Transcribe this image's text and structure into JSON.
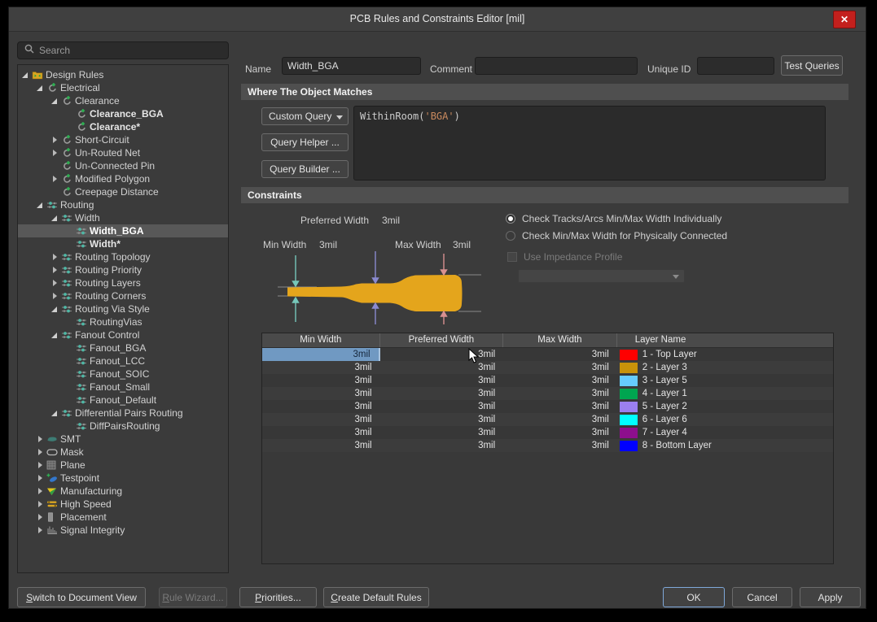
{
  "window": {
    "title": "PCB Rules and Constraints Editor [mil]",
    "close_label": "✕"
  },
  "sidebar": {
    "search_placeholder": "Search",
    "tree": [
      {
        "label": "Design Rules",
        "level": 0,
        "exp": "open",
        "icon": "folder-icon",
        "bold": false,
        "selected": false
      },
      {
        "label": "Electrical",
        "level": 1,
        "exp": "open",
        "icon": "rule-icon",
        "bold": false,
        "selected": false
      },
      {
        "label": "Clearance",
        "level": 2,
        "exp": "open",
        "icon": "rule-icon",
        "bold": false,
        "selected": false
      },
      {
        "label": "Clearance_BGA",
        "level": 3,
        "exp": "none",
        "icon": "rule-icon",
        "bold": true,
        "selected": false
      },
      {
        "label": "Clearance*",
        "level": 3,
        "exp": "none",
        "icon": "rule-icon",
        "bold": true,
        "selected": false
      },
      {
        "label": "Short-Circuit",
        "level": 2,
        "exp": "closed",
        "icon": "rule-icon",
        "bold": false,
        "selected": false
      },
      {
        "label": "Un-Routed Net",
        "level": 2,
        "exp": "closed",
        "icon": "rule-icon",
        "bold": false,
        "selected": false
      },
      {
        "label": "Un-Connected Pin",
        "level": 2,
        "exp": "none",
        "icon": "rule-icon",
        "bold": false,
        "selected": false
      },
      {
        "label": "Modified Polygon",
        "level": 2,
        "exp": "closed",
        "icon": "rule-icon",
        "bold": false,
        "selected": false
      },
      {
        "label": "Creepage Distance",
        "level": 2,
        "exp": "none",
        "icon": "rule-icon",
        "bold": false,
        "selected": false
      },
      {
        "label": "Routing",
        "level": 1,
        "exp": "open",
        "icon": "routing-icon",
        "bold": false,
        "selected": false
      },
      {
        "label": "Width",
        "level": 2,
        "exp": "open",
        "icon": "routing-icon",
        "bold": false,
        "selected": false
      },
      {
        "label": "Width_BGA",
        "level": 3,
        "exp": "none",
        "icon": "routing-icon",
        "bold": true,
        "selected": true
      },
      {
        "label": "Width*",
        "level": 3,
        "exp": "none",
        "icon": "routing-icon",
        "bold": true,
        "selected": false
      },
      {
        "label": "Routing Topology",
        "level": 2,
        "exp": "closed",
        "icon": "routing-icon",
        "bold": false,
        "selected": false
      },
      {
        "label": "Routing Priority",
        "level": 2,
        "exp": "closed",
        "icon": "routing-icon",
        "bold": false,
        "selected": false
      },
      {
        "label": "Routing Layers",
        "level": 2,
        "exp": "closed",
        "icon": "routing-icon",
        "bold": false,
        "selected": false
      },
      {
        "label": "Routing Corners",
        "level": 2,
        "exp": "closed",
        "icon": "routing-icon",
        "bold": false,
        "selected": false
      },
      {
        "label": "Routing Via Style",
        "level": 2,
        "exp": "open",
        "icon": "routing-icon",
        "bold": false,
        "selected": false
      },
      {
        "label": "RoutingVias",
        "level": 3,
        "exp": "none",
        "icon": "routing-icon",
        "bold": false,
        "selected": false
      },
      {
        "label": "Fanout Control",
        "level": 2,
        "exp": "open",
        "icon": "routing-icon",
        "bold": false,
        "selected": false
      },
      {
        "label": "Fanout_BGA",
        "level": 3,
        "exp": "none",
        "icon": "routing-icon",
        "bold": false,
        "selected": false
      },
      {
        "label": "Fanout_LCC",
        "level": 3,
        "exp": "none",
        "icon": "routing-icon",
        "bold": false,
        "selected": false
      },
      {
        "label": "Fanout_SOIC",
        "level": 3,
        "exp": "none",
        "icon": "routing-icon",
        "bold": false,
        "selected": false
      },
      {
        "label": "Fanout_Small",
        "level": 3,
        "exp": "none",
        "icon": "routing-icon",
        "bold": false,
        "selected": false
      },
      {
        "label": "Fanout_Default",
        "level": 3,
        "exp": "none",
        "icon": "routing-icon",
        "bold": false,
        "selected": false
      },
      {
        "label": "Differential Pairs Routing",
        "level": 2,
        "exp": "open",
        "icon": "routing-icon",
        "bold": false,
        "selected": false
      },
      {
        "label": "DiffPairsRouting",
        "level": 3,
        "exp": "none",
        "icon": "routing-icon",
        "bold": false,
        "selected": false
      },
      {
        "label": "SMT",
        "level": 1,
        "exp": "closed",
        "icon": "smt-icon",
        "bold": false,
        "selected": false
      },
      {
        "label": "Mask",
        "level": 1,
        "exp": "closed",
        "icon": "mask-icon",
        "bold": false,
        "selected": false
      },
      {
        "label": "Plane",
        "level": 1,
        "exp": "closed",
        "icon": "plane-icon",
        "bold": false,
        "selected": false
      },
      {
        "label": "Testpoint",
        "level": 1,
        "exp": "closed",
        "icon": "testpoint-icon",
        "bold": false,
        "selected": false
      },
      {
        "label": "Manufacturing",
        "level": 1,
        "exp": "closed",
        "icon": "manufacturing-icon",
        "bold": false,
        "selected": false
      },
      {
        "label": "High Speed",
        "level": 1,
        "exp": "closed",
        "icon": "highspeed-icon",
        "bold": false,
        "selected": false
      },
      {
        "label": "Placement",
        "level": 1,
        "exp": "closed",
        "icon": "placement-icon",
        "bold": false,
        "selected": false
      },
      {
        "label": "Signal Integrity",
        "level": 1,
        "exp": "closed",
        "icon": "signal-icon",
        "bold": false,
        "selected": false
      }
    ]
  },
  "form": {
    "name_label": "Name",
    "name_value": "Width_BGA",
    "comment_label": "Comment",
    "comment_value": "",
    "unique_id_label": "Unique ID",
    "unique_id_value": "",
    "test_queries_label": "Test Queries"
  },
  "where": {
    "header": "Where The Object Matches",
    "custom_query_label": "Custom Query",
    "query_helper_label": "Query Helper ...",
    "query_builder_label": "Query Builder ...",
    "query_prefix": "WithinRoom(",
    "query_string": "'BGA'",
    "query_suffix": ")"
  },
  "constraints": {
    "header": "Constraints",
    "preferred_width_label": "Preferred Width",
    "preferred_width_value": "3mil",
    "min_width_label": "Min Width",
    "min_width_value": "3mil",
    "max_width_label": "Max Width",
    "max_width_value": "3mil",
    "radio1_label": "Check Tracks/Arcs Min/Max Width Individually",
    "radio1_selected": true,
    "radio2_label": "Check Min/Max Width for Physically Connected",
    "radio2_selected": false,
    "impedance_label": "Use Impedance Profile",
    "impedance_enabled": false,
    "impedance_value": ""
  },
  "table": {
    "headers": [
      "Min Width",
      "Preferred Width",
      "Max Width",
      "Layer Name"
    ],
    "selected_cell": {
      "row": 0,
      "col": 0
    },
    "rows": [
      {
        "min": "3mil",
        "preferred": "3mil",
        "max": "3mil",
        "layer": "1 - Top Layer",
        "color": "#ff0000"
      },
      {
        "min": "3mil",
        "preferred": "3mil",
        "max": "3mil",
        "layer": "2 - Layer 3",
        "color": "#c9920a"
      },
      {
        "min": "3mil",
        "preferred": "3mil",
        "max": "3mil",
        "layer": "3 - Layer 5",
        "color": "#66ccff"
      },
      {
        "min": "3mil",
        "preferred": "3mil",
        "max": "3mil",
        "layer": "4 - Layer 1",
        "color": "#00a550"
      },
      {
        "min": "3mil",
        "preferred": "3mil",
        "max": "3mil",
        "layer": "5 - Layer 2",
        "color": "#9b7ff0"
      },
      {
        "min": "3mil",
        "preferred": "3mil",
        "max": "3mil",
        "layer": "6 - Layer 6",
        "color": "#00ffff"
      },
      {
        "min": "3mil",
        "preferred": "3mil",
        "max": "3mil",
        "layer": "7 - Layer 4",
        "color": "#8d0f8d"
      },
      {
        "min": "3mil",
        "preferred": "3mil",
        "max": "3mil",
        "layer": "8 - Bottom Layer",
        "color": "#0000ff"
      }
    ]
  },
  "footer": {
    "left_buttons": [
      {
        "label": "Switch to Document View",
        "underline": "S",
        "enabled": true
      },
      {
        "label": "Rule Wizard...",
        "underline": "R",
        "enabled": false
      },
      {
        "label": "Priorities...",
        "underline": "P",
        "enabled": true
      },
      {
        "label": "Create Default Rules",
        "underline": "C",
        "enabled": true
      }
    ],
    "right_buttons": [
      {
        "label": "OK",
        "default": true
      },
      {
        "label": "Cancel",
        "default": false
      },
      {
        "label": "Apply",
        "default": false
      }
    ]
  },
  "colors": {
    "trace_gold": "#e4a51c",
    "min_arrow": "#76c7ba",
    "preferred_arrow": "#8a8ad0",
    "max_arrow": "#d89090",
    "selected_cell_bg": "#7099c2",
    "close_button": "#c3201d"
  }
}
